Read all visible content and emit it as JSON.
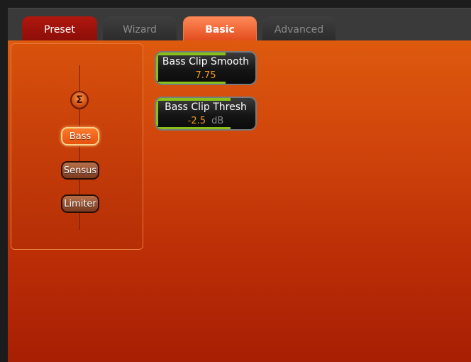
{
  "tabs": [
    {
      "label": "Preset"
    },
    {
      "label": "Wizard"
    },
    {
      "label": "Basic"
    },
    {
      "label": "Advanced"
    }
  ],
  "sidebar": {
    "sigma_symbol": "Σ",
    "modules": [
      {
        "label": "Bass"
      },
      {
        "label": "Sensus"
      },
      {
        "label": "Limiter"
      }
    ]
  },
  "params": [
    {
      "name": "Bass Clip Smooth",
      "value": "7.75",
      "unit": "",
      "fill": 0.7
    },
    {
      "name": "Bass Clip Thresh",
      "value": "-2.5",
      "unit": "dB",
      "fill": 0.75
    }
  ],
  "colors": {
    "accent_green": "#87c11a",
    "value_orange": "#f59a1a",
    "panel_orange": "#d8520c"
  }
}
